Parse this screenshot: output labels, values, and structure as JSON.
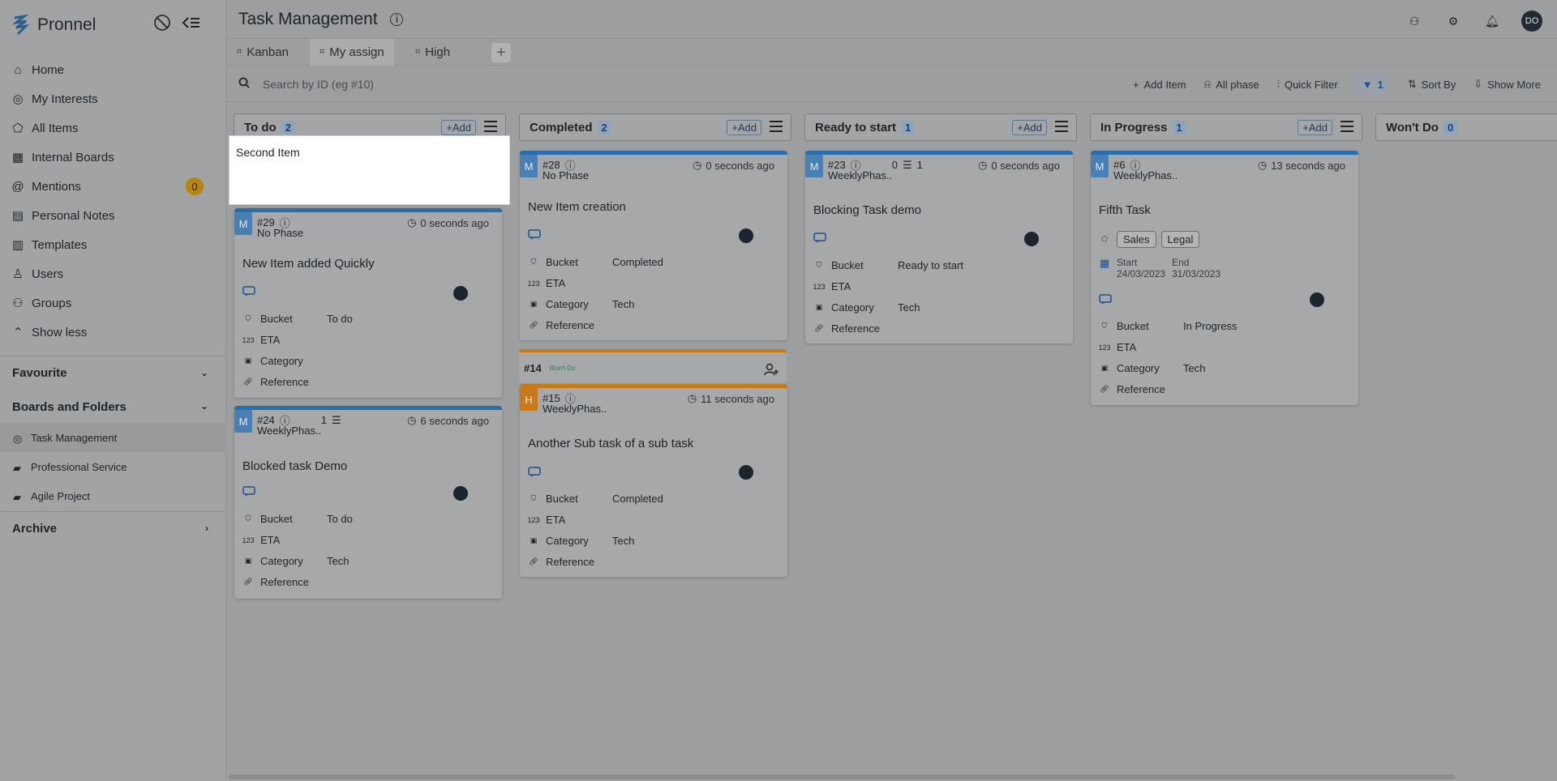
{
  "app": {
    "name": "Pronnel"
  },
  "sidebar": {
    "items": [
      {
        "label": "Home",
        "icon": "home-icon"
      },
      {
        "label": "My Interests",
        "icon": "target-icon"
      },
      {
        "label": "All Items",
        "icon": "tag-icon"
      },
      {
        "label": "Internal Boards",
        "icon": "grid-icon"
      },
      {
        "label": "Mentions",
        "icon": "at-icon",
        "badge": "0"
      },
      {
        "label": "Personal Notes",
        "icon": "note-icon"
      },
      {
        "label": "Templates",
        "icon": "template-icon"
      },
      {
        "label": "Users",
        "icon": "user-icon"
      },
      {
        "label": "Groups",
        "icon": "group-icon"
      },
      {
        "label": "Show less",
        "icon": "chevron-up-icon"
      }
    ],
    "favourite": "Favourite",
    "boards_folders": "Boards and Folders",
    "folders": [
      "Task Management",
      "Professional Service",
      "Agile Project"
    ],
    "archive": "Archive"
  },
  "header": {
    "title": "Task Management",
    "avatar": "DO"
  },
  "tabs": [
    "Kanban",
    "My assign",
    "High"
  ],
  "toolbar": {
    "search_placeholder": "Search by ID (eg #10)",
    "add_item": "Add Item",
    "all_phase": "All phase",
    "quick_filter": "Quick Filter",
    "filter_count": "1",
    "sort_by": "Sort By",
    "show_more": "Show More"
  },
  "add_label": "+Add",
  "columns": [
    {
      "name": "To do",
      "count": "2"
    },
    {
      "name": "Completed",
      "count": "2"
    },
    {
      "name": "Ready to start",
      "count": "1"
    },
    {
      "name": "In Progress",
      "count": "1"
    },
    {
      "name": "Won't Do",
      "count": "0"
    }
  ],
  "quick_add": {
    "value": "Second Item"
  },
  "field_labels": {
    "bucket": "Bucket",
    "eta": "ETA",
    "category": "Category",
    "reference": "Reference",
    "start": "Start",
    "end": "End"
  },
  "cards": {
    "c29": {
      "tag": "M",
      "id": "#29",
      "phase": "No Phase",
      "time": "0 seconds ago",
      "title": "New Item added Quickly",
      "bucket": "To do",
      "category": ""
    },
    "c24": {
      "tag": "M",
      "id": "#24",
      "phase": "WeeklyPhas..",
      "time": "6 seconds ago",
      "title": "Blocked task Demo",
      "bucket": "To do",
      "category": "Tech",
      "subtasks": "1"
    },
    "c28": {
      "tag": "M",
      "id": "#28",
      "phase": "No Phase",
      "time": "0 seconds ago",
      "title": "New Item creation",
      "bucket": "Completed",
      "category": "Tech"
    },
    "c15": {
      "tag": "H",
      "id": "#15",
      "phase": "WeeklyPhas..",
      "time": "11 seconds ago",
      "title": "Another Sub task of a sub task",
      "bucket": "Completed",
      "category": "Tech"
    },
    "c23": {
      "tag": "M",
      "id": "#23",
      "phase": "WeeklyPhas..",
      "time": "0 seconds ago",
      "title": "Blocking Task demo",
      "bucket": "Ready to start",
      "category": "Tech",
      "sub0": "0",
      "sub1": "1"
    },
    "c6": {
      "tag": "M",
      "id": "#6",
      "phase": "WeeklyPhas..",
      "time": "13 seconds ago",
      "title": "Fifth Task",
      "bucket": "In Progress",
      "category": "Tech",
      "tags": [
        "Sales",
        "Legal"
      ],
      "start": "24/03/2023",
      "end": "31/03/2023"
    }
  },
  "sub_group": {
    "id": "#14",
    "status": "Won't Do"
  }
}
